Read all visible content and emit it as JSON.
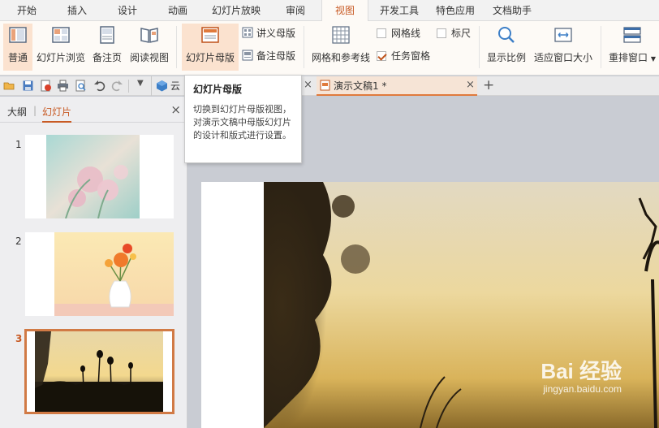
{
  "menu": {
    "tabs": [
      "开始",
      "插入",
      "设计",
      "动画",
      "幻灯片放映",
      "审阅",
      "视图",
      "开发工具",
      "特色应用",
      "文档助手"
    ],
    "active": "视图"
  },
  "ribbon": {
    "normal": "普通",
    "slide_sorter": "幻灯片浏览",
    "notes_page": "备注页",
    "reading_view": "阅读视图",
    "slide_master": "幻灯片母版",
    "handout_master": "讲义母版",
    "notes_master": "备注母版",
    "grid_guides": "网格和参考线",
    "gridlines": "网格线",
    "ruler": "标尺",
    "task_pane": "任务窗格",
    "zoom": "显示比例",
    "fit_window": "适应窗口大小",
    "arrange": "重排窗口"
  },
  "doc_tabs": {
    "cloud": "云",
    "doc1": "演示文稿1 *",
    "add": "+"
  },
  "tooltip": {
    "title": "幻灯片母版",
    "body": "切换到幻灯片母版视图，对演示文稿中母版幻灯片的设计和版式进行设置。"
  },
  "left_panel": {
    "outline_tab": "大纲",
    "divider": "|",
    "slides_tab": "幻灯片",
    "close": "×",
    "slides": [
      {
        "number": "1",
        "selected": false
      },
      {
        "number": "2",
        "selected": false
      },
      {
        "number": "3",
        "selected": true
      }
    ]
  },
  "watermark": {
    "main": "Bai 经验",
    "sub": "jingyan.baidu.com"
  },
  "colors": {
    "accent": "#c85a24",
    "active_ribbon": "#fbe2cf",
    "ribbon_bg": "#fdfaf6",
    "canvas_bg": "#c9ccd3"
  }
}
